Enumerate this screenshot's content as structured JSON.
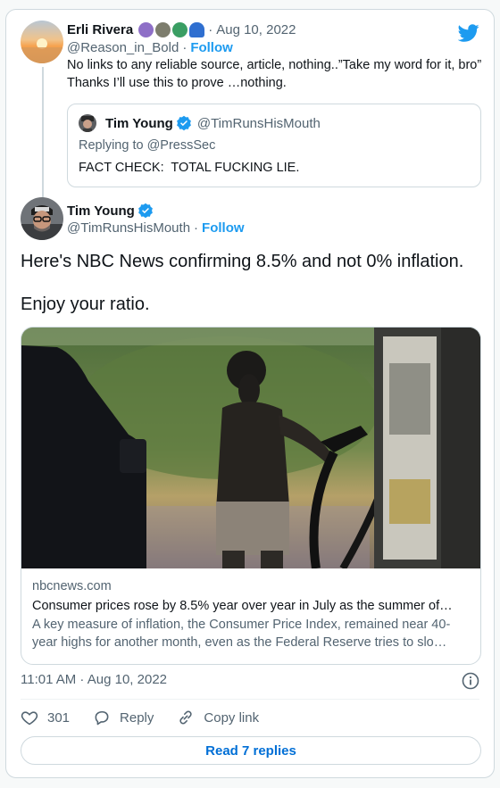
{
  "reply": {
    "name": "Erli Rivera",
    "emoji_icons": [
      "peace-symbol-icon",
      "moon-phase-icon",
      "globe-icon",
      "blue-cap-icon"
    ],
    "date": "Aug 10, 2022",
    "handle": "@Reason_in_Bold",
    "follow": "Follow",
    "text": "No links to any reliable source, article, nothing..”Take my word for it, bro” Thanks I’ll use this to prove …nothing."
  },
  "quoted": {
    "name": "Tim Young",
    "handle": "@TimRunsHisMouth",
    "replying_to": "Replying to @PressSec",
    "text": "FACT CHECK:  TOTAL FUCKING LIE."
  },
  "main": {
    "name": "Tim Young",
    "handle": "@TimRunsHisMouth",
    "follow": "Follow",
    "text_line1": "Here's NBC News confirming 8.5% and not 0% inflation.",
    "text_line2": "Enjoy your ratio.",
    "link": {
      "domain": "nbcnews.com",
      "title": "Consumer prices rose by 8.5% year over year in July as the summer of…",
      "description": "A key measure of inflation, the Consumer Price Index, remained near 40-year highs for another month, even as the Federal Reserve tries to slo…"
    },
    "timestamp": "11:01 AM · Aug 10, 2022",
    "likes": "301",
    "reply_label": "Reply",
    "copy_label": "Copy link",
    "read_replies": "Read 7 replies"
  },
  "colors": {
    "accent": "#1d9bf0",
    "muted": "#536471",
    "border": "#cfd9de"
  }
}
